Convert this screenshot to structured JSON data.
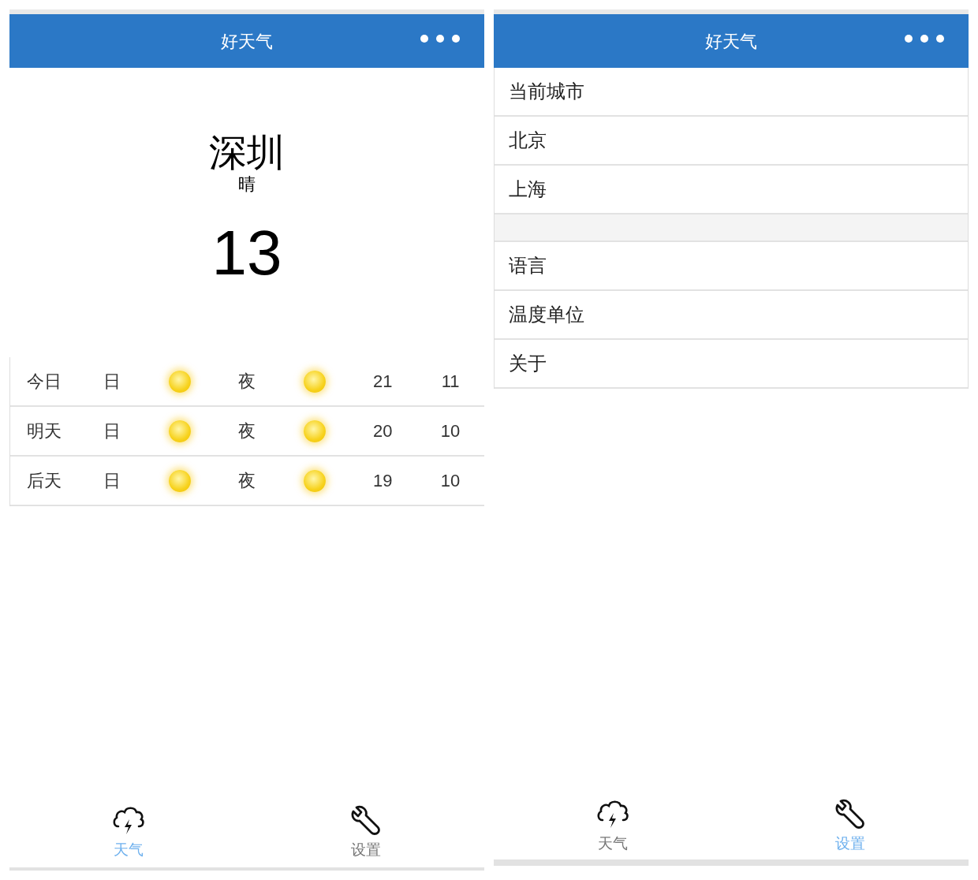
{
  "screens": [
    {
      "kind": "weather",
      "title": "好天气",
      "city": "深圳",
      "condition": "晴",
      "temperature": "13",
      "forecast": [
        {
          "day": "今日",
          "day_label": "日",
          "night_label": "夜",
          "high": "21",
          "low": "11"
        },
        {
          "day": "明天",
          "day_label": "日",
          "night_label": "夜",
          "high": "20",
          "low": "10"
        },
        {
          "day": "后天",
          "day_label": "日",
          "night_label": "夜",
          "high": "19",
          "low": "10"
        }
      ],
      "tabs": [
        {
          "label": "天气",
          "selected": true
        },
        {
          "label": "设置",
          "selected": false
        }
      ]
    },
    {
      "kind": "settings",
      "title": "好天气",
      "groups": [
        [
          "当前城市",
          "北京",
          "上海"
        ],
        [
          "语言",
          "温度单位",
          "关于"
        ]
      ],
      "tabs": [
        {
          "label": "天气",
          "selected": false
        },
        {
          "label": "设置",
          "selected": true
        }
      ]
    }
  ]
}
